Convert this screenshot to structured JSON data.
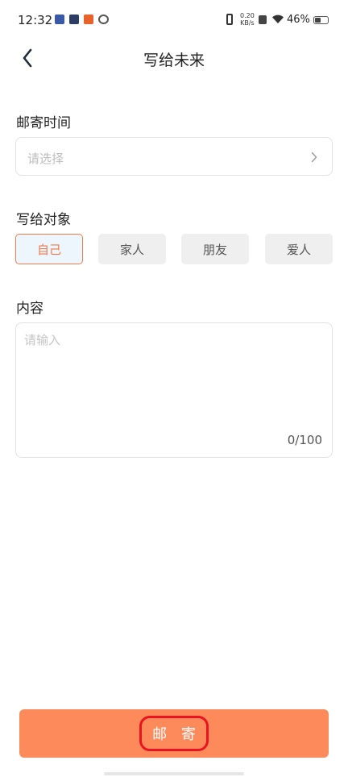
{
  "status_bar": {
    "time": "12:32",
    "net_speed_value": "0.20",
    "net_speed_unit": "KB/s",
    "battery_percent": "46%",
    "battery_level": 0.46
  },
  "header": {
    "title": "写给未来",
    "back_icon": "chevron-left-icon"
  },
  "mail_time": {
    "label": "邮寄时间",
    "placeholder": "请选择",
    "chevron_icon": "chevron-right-icon"
  },
  "recipient": {
    "label": "写给对象",
    "options": [
      "自己",
      "家人",
      "朋友",
      "爱人"
    ],
    "selected": "自己"
  },
  "content": {
    "label": "内容",
    "placeholder": "请输入",
    "char_count": "0/100"
  },
  "submit": {
    "label": "邮 寄"
  },
  "colors": {
    "accent": "#fd8a5a",
    "active_border": "#f07a4a",
    "highlight_ring": "#e8141f"
  }
}
